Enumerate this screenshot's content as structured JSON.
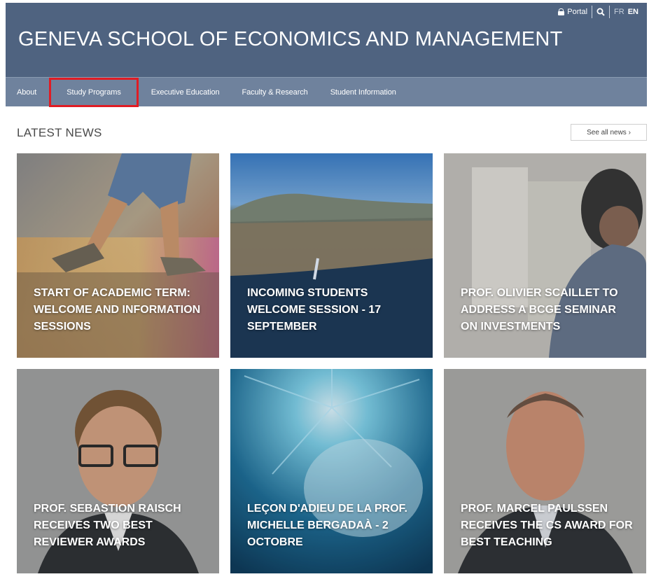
{
  "header": {
    "title": "GENEVA SCHOOL OF ECONOMICS AND MANAGEMENT",
    "utility": {
      "portal_label": "Portal",
      "lang_fr": "FR",
      "lang_en": "EN"
    }
  },
  "nav": {
    "items": [
      {
        "label": "About"
      },
      {
        "label": "Study Programs"
      },
      {
        "label": "Executive Education"
      },
      {
        "label": "Faculty & Research"
      },
      {
        "label": "Student Information"
      }
    ]
  },
  "news": {
    "section_title": "LATEST NEWS",
    "see_all_label": "See all news ›",
    "tiles": [
      {
        "caption": "START OF ACADEMIC TERM: WELCOME AND INFORMATION SESSIONS"
      },
      {
        "caption": "INCOMING STUDENTS WELCOME SESSION - 17 SEPTEMBER"
      },
      {
        "caption": "PROF. OLIVIER SCAILLET TO ADDRESS A BCGE SEMINAR ON INVESTMENTS"
      },
      {
        "caption": "PROF. SEBASTION RAISCH RECEIVES TWO BEST REVIEWER AWARDS"
      },
      {
        "caption": "LEÇON D'ADIEU DE LA PROF. MICHELLE BERGADAÀ - 2 OCTOBRE"
      },
      {
        "caption": "PROF. MARCEL PAULSSEN RECEIVES THE CS AWARD FOR BEST TEACHING"
      }
    ]
  },
  "colors": {
    "header_bg": "#4f6380",
    "nav_bg": "#6f829d",
    "highlight": "#e01c24"
  },
  "icons": {
    "portal": "lock-icon",
    "search": "search-icon"
  }
}
